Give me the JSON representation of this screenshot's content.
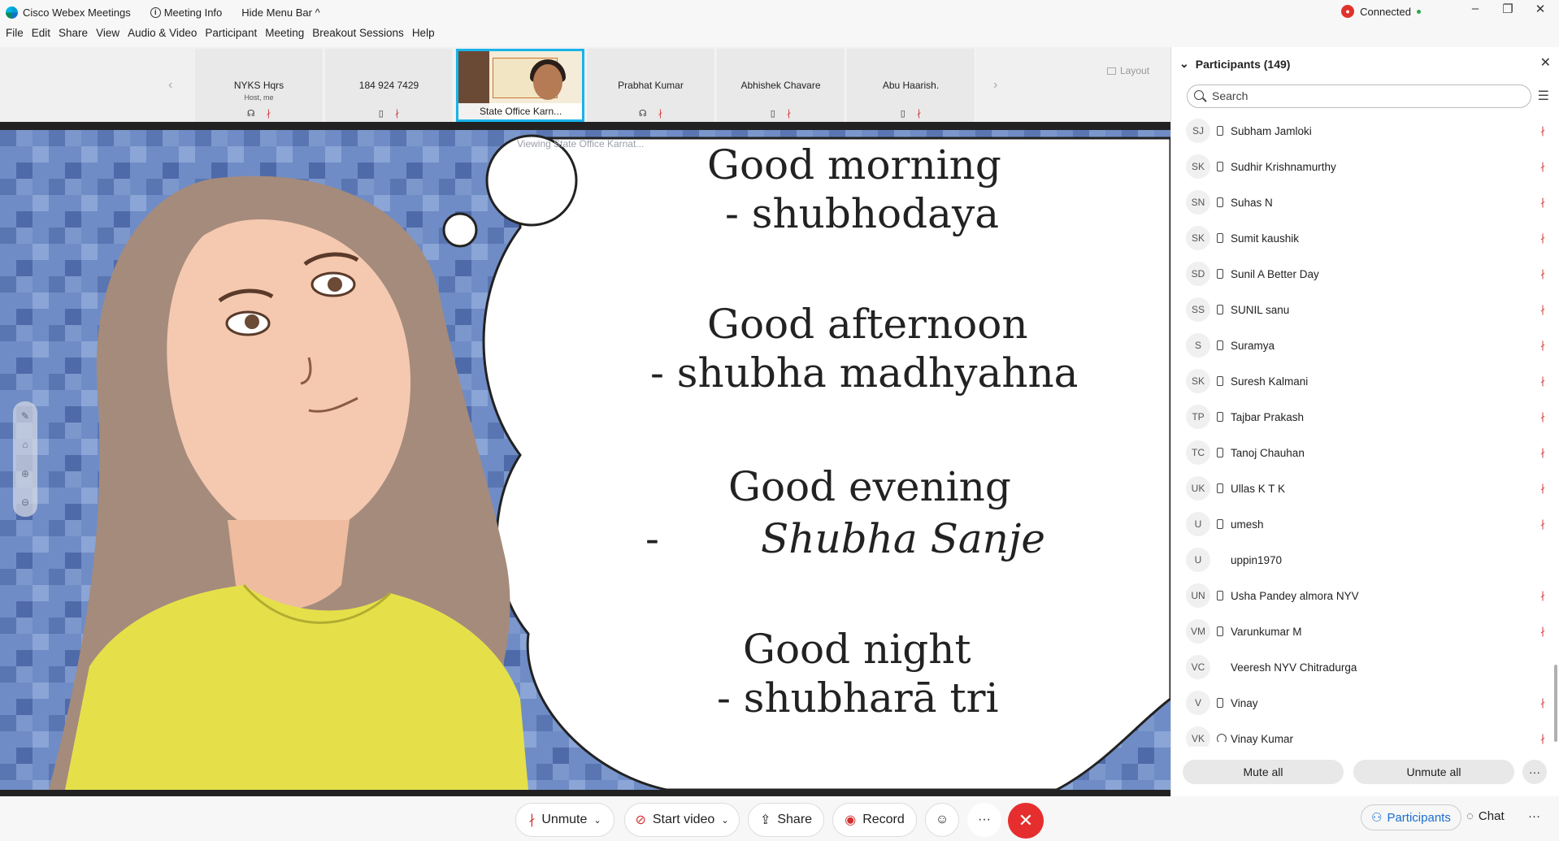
{
  "window": {
    "app_name": "Cisco Webex Meetings",
    "meeting_info": "Meeting Info",
    "hide_menu_bar": "Hide Menu Bar ^",
    "status": "Connected"
  },
  "menu": [
    "File",
    "Edit",
    "Share",
    "View",
    "Audio & Video",
    "Participant",
    "Meeting",
    "Breakout Sessions",
    "Help"
  ],
  "filmstrip": {
    "tiles": [
      {
        "name": "NYKS Hqrs",
        "sub": "Host, me"
      },
      {
        "name": "184 924 7429",
        "sub": ""
      },
      {
        "name": "State Office Karn...",
        "sub": ""
      },
      {
        "name": "Prabhat Kumar",
        "sub": ""
      },
      {
        "name": "Abhishek Chavare",
        "sub": ""
      },
      {
        "name": "Abu Haarish.",
        "sub": ""
      }
    ],
    "layout_label": "Layout"
  },
  "stage": {
    "viewing": "Viewing State Office Karnat...",
    "lines": [
      "Good morning",
      "- shubhodaya",
      "Good afternoon",
      "- shubha madhyahna",
      "Good evening",
      "-",
      "Shubha Sanje",
      "Good night",
      "- shubharā tri"
    ]
  },
  "participants": {
    "header": "Participants (149)",
    "search_placeholder": "Search",
    "list": [
      {
        "initials": "SJ",
        "name": "Subham Jamloki",
        "device": "phone",
        "mic": true
      },
      {
        "initials": "SK",
        "name": "Sudhir Krishnamurthy",
        "device": "phone",
        "mic": true
      },
      {
        "initials": "SN",
        "name": "Suhas N",
        "device": "phone",
        "mic": true
      },
      {
        "initials": "SK",
        "name": "Sumit kaushik",
        "device": "phone",
        "mic": true
      },
      {
        "initials": "SD",
        "name": "Sunil A Better Day",
        "device": "phone",
        "mic": true
      },
      {
        "initials": "SS",
        "name": "SUNIL sanu",
        "device": "phone",
        "mic": true
      },
      {
        "initials": "S",
        "name": "Suramya",
        "device": "phone",
        "mic": true
      },
      {
        "initials": "SK",
        "name": "Suresh Kalmani",
        "device": "phone",
        "mic": true
      },
      {
        "initials": "TP",
        "name": "Tajbar Prakash",
        "device": "phone",
        "mic": true
      },
      {
        "initials": "TC",
        "name": "Tanoj Chauhan",
        "device": "phone",
        "mic": true
      },
      {
        "initials": "UK",
        "name": "Ullas K T K",
        "device": "phone",
        "mic": true
      },
      {
        "initials": "U",
        "name": "umesh",
        "device": "phone",
        "mic": true
      },
      {
        "initials": "U",
        "name": "uppin1970",
        "device": "",
        "mic": false
      },
      {
        "initials": "UN",
        "name": "Usha Pandey almora NYV",
        "device": "phone",
        "mic": true
      },
      {
        "initials": "VM",
        "name": "Varunkumar M",
        "device": "phone",
        "mic": true
      },
      {
        "initials": "VC",
        "name": "Veeresh NYV Chitradurga",
        "device": "",
        "mic": false
      },
      {
        "initials": "V",
        "name": "Vinay",
        "device": "phone",
        "mic": true
      },
      {
        "initials": "VK",
        "name": "Vinay Kumar",
        "device": "headset",
        "mic": true
      }
    ],
    "mute_all": "Mute all",
    "unmute_all": "Unmute all"
  },
  "controls": {
    "unmute": "Unmute",
    "start_video": "Start video",
    "share": "Share",
    "record": "Record",
    "participants": "Participants",
    "chat": "Chat"
  }
}
